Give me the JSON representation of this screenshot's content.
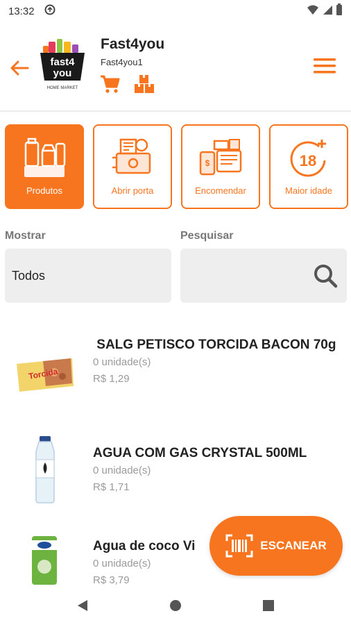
{
  "status": {
    "time": "13:32",
    "icons": [
      "sync-icon",
      "wifi-icon",
      "signal-icon",
      "battery-icon"
    ]
  },
  "header": {
    "store_name": "Fast4you",
    "user_name": "Fast4you1",
    "logo_text": "fast4you",
    "logo_tagline": "HOME MARKET",
    "icons": [
      "back-arrow-icon",
      "cart-icon",
      "boxes-icon",
      "hamburger-menu-icon"
    ]
  },
  "tiles": [
    {
      "label": "Produtos",
      "icon": "products-icon",
      "active": true
    },
    {
      "label": "Abrir porta",
      "icon": "open-door-icon",
      "active": false
    },
    {
      "label": "Encomendar",
      "icon": "order-icon",
      "active": false
    },
    {
      "label": "Maior idade",
      "icon": "age-18-plus-icon",
      "active": false
    }
  ],
  "filters": {
    "show_label": "Mostrar",
    "show_value": "Todos",
    "search_label": "Pesquisar",
    "search_placeholder": ""
  },
  "products": [
    {
      "name": " SALG PETISCO TORCIDA BACON 70g",
      "quantity": "0 unidade(s)",
      "price": "R$ 1,29",
      "thumb": "snack-bag-image"
    },
    {
      "name": "AGUA COM GAS CRYSTAL 500ML",
      "quantity": "0 unidade(s)",
      "price": "R$ 1,71",
      "thumb": "water-bottle-image"
    },
    {
      "name": "Agua de coco Vi",
      "quantity": "0 unidade(s)",
      "price": "R$ 3,79",
      "thumb": "coconut-water-can-image"
    }
  ],
  "scan_button": {
    "label": "ESCANEAR",
    "icon": "barcode-scan-icon"
  },
  "nav": {
    "icons": [
      "nav-back-icon",
      "nav-home-icon",
      "nav-recents-icon"
    ]
  },
  "colors": {
    "accent": "#f7751e",
    "field_bg": "#eeeeee",
    "muted_text": "#9a9a9a"
  }
}
